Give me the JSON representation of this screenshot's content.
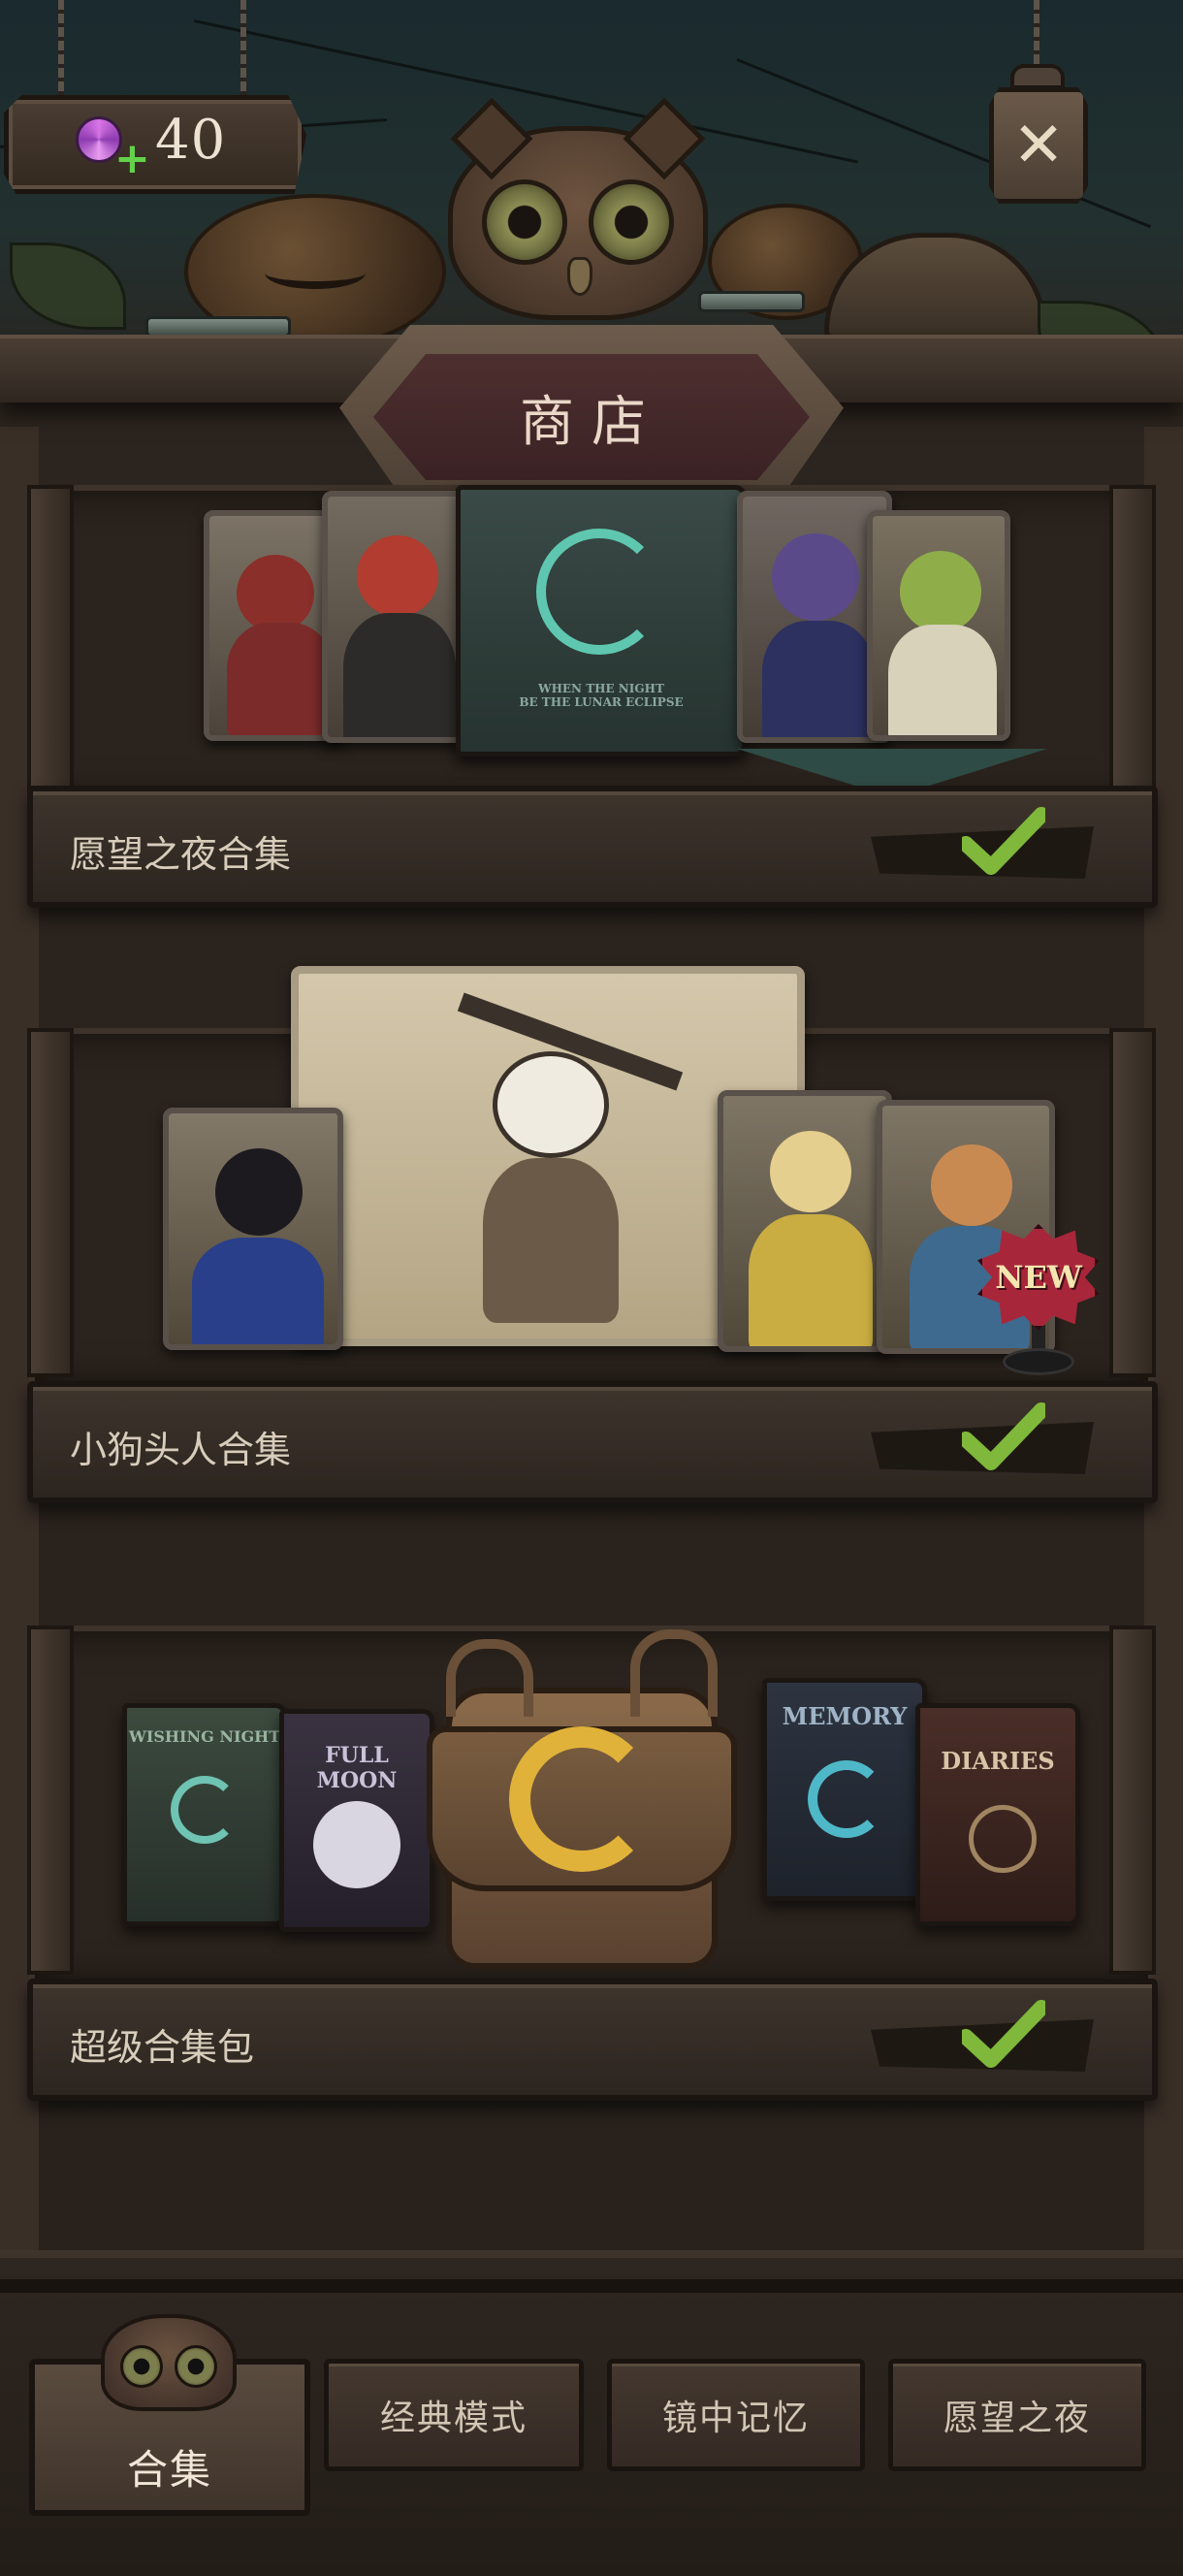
{
  "header": {
    "currency": {
      "icon": "candy-plus-icon",
      "value": "40"
    },
    "close_icon": "close-icon",
    "title": "商店"
  },
  "shelves": [
    {
      "label": "愿望之夜合集",
      "owned": true,
      "status_icon": "checkmark-icon",
      "center_book_text": "WHEN THE NIGHT\nBE THE LUNAR ECLIPSE"
    },
    {
      "label": "小狗头人合集",
      "owned": true,
      "status_icon": "checkmark-icon",
      "badge": "NEW"
    },
    {
      "label": "超级合集包",
      "owned": true,
      "status_icon": "checkmark-icon",
      "books": [
        "WISHING NIGHT",
        "FULL MOON",
        "MEMORY",
        "DIARIES"
      ]
    }
  ],
  "nav": {
    "tabs": [
      {
        "label": "合集",
        "active": true
      },
      {
        "label": "经典模式",
        "active": false
      },
      {
        "label": "镜中记忆",
        "active": false
      },
      {
        "label": "愿望之夜",
        "active": false
      }
    ]
  },
  "colors": {
    "check_green": "#7fb83a",
    "wood_dark": "#2c241e",
    "title_plaque": "#4e2f2f",
    "new_badge": "#a8263a"
  }
}
